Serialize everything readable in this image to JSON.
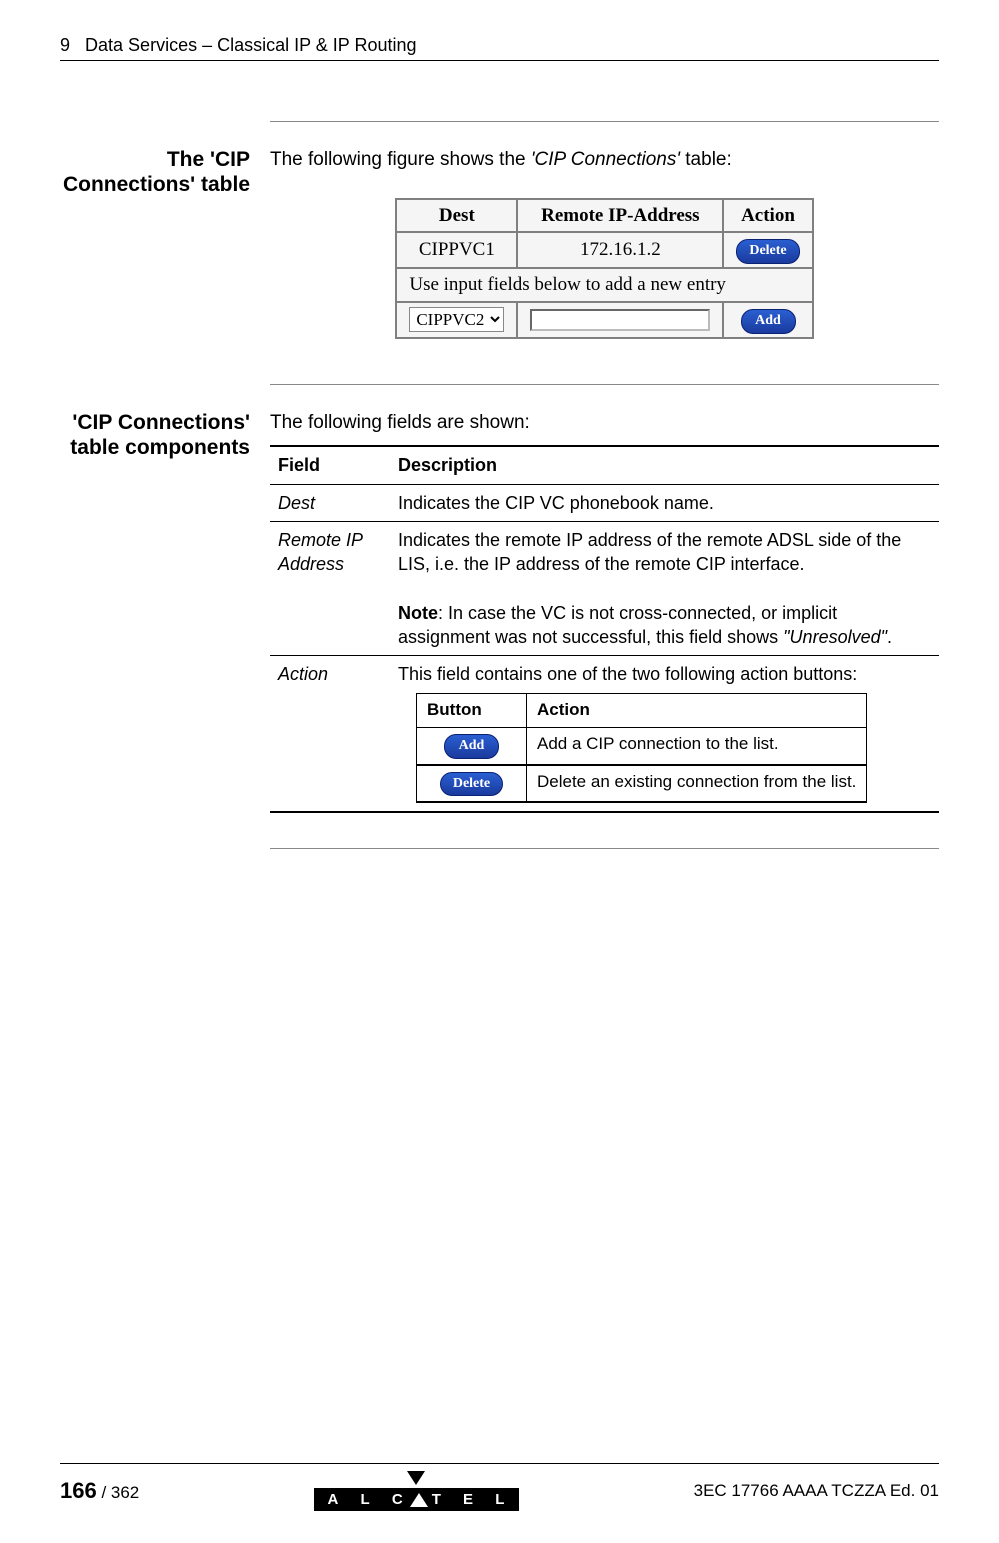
{
  "header": {
    "chapter_num": "9",
    "chapter_title": "Data Services – Classical IP & IP Routing"
  },
  "section1": {
    "heading": "The 'CIP Connections' table",
    "intro_pre": "The following figure shows the ",
    "intro_em": "'CIP Connections'",
    "intro_post": " table:",
    "fig": {
      "th_dest": "Dest",
      "th_remote": "Remote IP-Address",
      "th_action": "Action",
      "row1_dest": "CIPPVC1",
      "row1_ip": "172.16.1.2",
      "row1_btn": "Delete",
      "row2_span": "Use input fields below to add a new entry",
      "row3_select": "CIPPVC2",
      "row3_btn": "Add"
    }
  },
  "section2": {
    "heading": "'CIP Connections' table components",
    "intro": "The following fields are shown:",
    "th_field": "Field",
    "th_desc": "Description",
    "rows": {
      "dest": {
        "name": "Dest",
        "desc": "Indicates the CIP VC phonebook name."
      },
      "remote": {
        "name": "Remote IP Address",
        "desc1": "Indicates the remote IP address of the remote ADSL side of the LIS, i.e. the IP address of the remote CIP interface.",
        "note_label": "Note",
        "note_mid": ": In case the VC is not cross-connected, or implicit assignment was not successful, this field shows ",
        "note_em": "\"Unresolved\"",
        "note_end": "."
      },
      "action": {
        "name": "Action",
        "desc": "This field contains one of the two following action buttons:",
        "th_button": "Button",
        "th_action": "Action",
        "add_btn": "Add",
        "add_desc": "Add a CIP connection to the list.",
        "del_btn": "Delete",
        "del_desc": "Delete an existing connection from the list."
      }
    }
  },
  "footer": {
    "page_current": "166",
    "page_sep": " / ",
    "page_total": "362",
    "logo": "ALCATEL",
    "docref": "3EC 17766 AAAA TCZZA Ed. 01"
  }
}
